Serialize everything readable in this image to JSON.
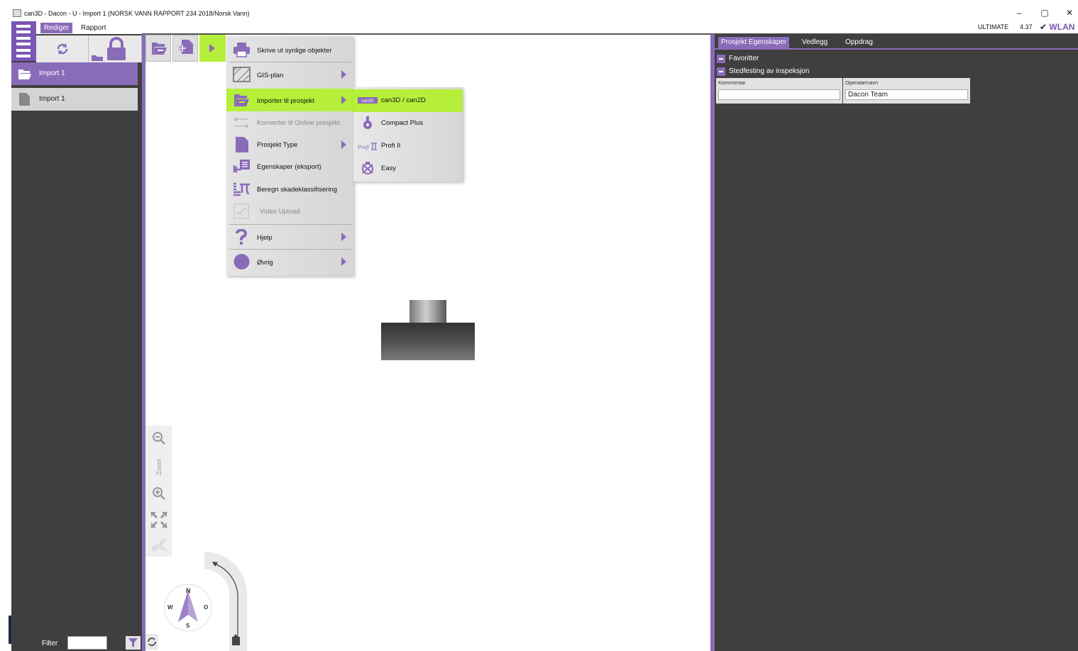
{
  "window": {
    "title": "can3D - Dacon - U - Import 1 (NORSK VANN RAPPORT 234 2018/Norsk Vann)",
    "controls": [
      "–",
      "▢",
      "✕"
    ]
  },
  "menubar": {
    "tabs": [
      "Rediger",
      "Rapport"
    ],
    "edition": "ULTIMATE",
    "version": "4.37",
    "network": "WLAN"
  },
  "tree": {
    "items": [
      {
        "label": "Import 1",
        "icon": "folder-open-icon"
      },
      {
        "label": "Import 1",
        "icon": "document-icon"
      }
    ]
  },
  "filter": {
    "label": "Filter",
    "value": ""
  },
  "zoom": {
    "label": "Zoom"
  },
  "compass": {
    "n": "N",
    "s": "S",
    "w": "W",
    "e": "O"
  },
  "main_menu": {
    "items": [
      {
        "label": "Skrive ut synlige objekter",
        "icon": "printer-icon",
        "submenu": false,
        "enabled": true,
        "highlighted": false
      },
      {
        "label": "GIS-plan",
        "icon": "map-grid-icon",
        "submenu": true,
        "enabled": true,
        "highlighted": false
      },
      {
        "label": "Importer til prosjekt",
        "icon": "import-folder-icon",
        "submenu": true,
        "enabled": true,
        "highlighted": true
      },
      {
        "label": "Konverter til Online prosjekt",
        "icon": "convert-arrows-icon",
        "submenu": false,
        "enabled": false,
        "highlighted": false
      },
      {
        "label": "Prosjekt Type",
        "icon": "document-icon",
        "submenu": true,
        "enabled": true,
        "highlighted": false
      },
      {
        "label": "Egenskaper (eksport)",
        "icon": "export-properties-icon",
        "submenu": false,
        "enabled": true,
        "highlighted": false
      },
      {
        "label": "Beregn skadeklassifisering",
        "icon": "calculate-pi-icon",
        "submenu": false,
        "enabled": true,
        "highlighted": false
      },
      {
        "label": "Video Upload",
        "icon": "checkbox-icon",
        "submenu": false,
        "enabled": false,
        "highlighted": false
      },
      {
        "label": "Hjelp",
        "icon": "question-icon",
        "submenu": true,
        "enabled": true,
        "highlighted": false
      },
      {
        "label": "Øvrig",
        "icon": "circle-icon",
        "submenu": true,
        "enabled": true,
        "highlighted": false
      }
    ]
  },
  "sub_menu": {
    "items": [
      {
        "label": "can3D / can2D",
        "icon": "can3d-logo-icon",
        "highlighted": true
      },
      {
        "label": "Compact Plus",
        "icon": "compact-plus-icon",
        "highlighted": false
      },
      {
        "label": "Profi II",
        "icon": "profi-logo-icon",
        "highlighted": false
      },
      {
        "label": "Easy",
        "icon": "easy-logo-icon",
        "highlighted": false
      }
    ]
  },
  "right_panel": {
    "tabs": [
      "Prosjekt Egenskaper",
      "Vedlegg",
      "Oppdrag"
    ],
    "sections": [
      "Favoritter",
      "Stedfesting av inspeksjon"
    ],
    "fields": [
      {
        "label": "Kommentar",
        "value": ""
      },
      {
        "label": "Operatørnavn",
        "value": "Dacon Team"
      }
    ]
  },
  "colors": {
    "accent": "#8a6bb8",
    "highlight": "#b5ef3a",
    "panel": "#3f3f3f"
  }
}
